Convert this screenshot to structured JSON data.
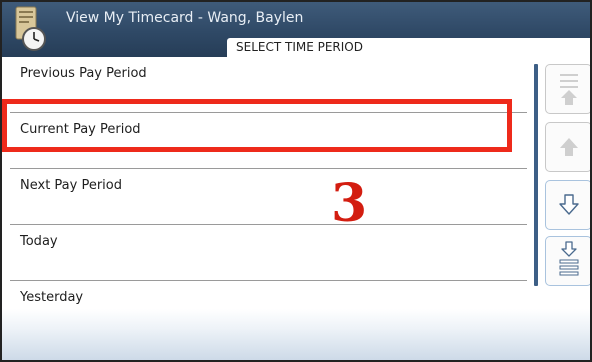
{
  "window": {
    "title": "View My Timecard - Wang, Baylen",
    "subheader": "SELECT TIME PERIOD"
  },
  "periods": [
    {
      "label": "Previous Pay Period"
    },
    {
      "label": "Current Pay Period"
    },
    {
      "label": "Next Pay Period"
    },
    {
      "label": "Today"
    },
    {
      "label": "Yesterday"
    }
  ],
  "selected_period": "Current Pay Period",
  "annotation": {
    "step_number": "3",
    "highlight_color": "#ee2a1b",
    "text_color": "#d31d10"
  },
  "scroll_buttons": [
    {
      "name": "scroll-to-top",
      "icon": "double-arrow-up-icon",
      "enabled": false
    },
    {
      "name": "scroll-up",
      "icon": "arrow-up-icon",
      "enabled": false
    },
    {
      "name": "scroll-down",
      "icon": "arrow-down-icon",
      "enabled": true
    },
    {
      "name": "scroll-to-bottom",
      "icon": "double-arrow-down-icon",
      "enabled": true
    }
  ],
  "colors": {
    "titlebar": "#2f4966",
    "accent": "#3d5f86"
  }
}
